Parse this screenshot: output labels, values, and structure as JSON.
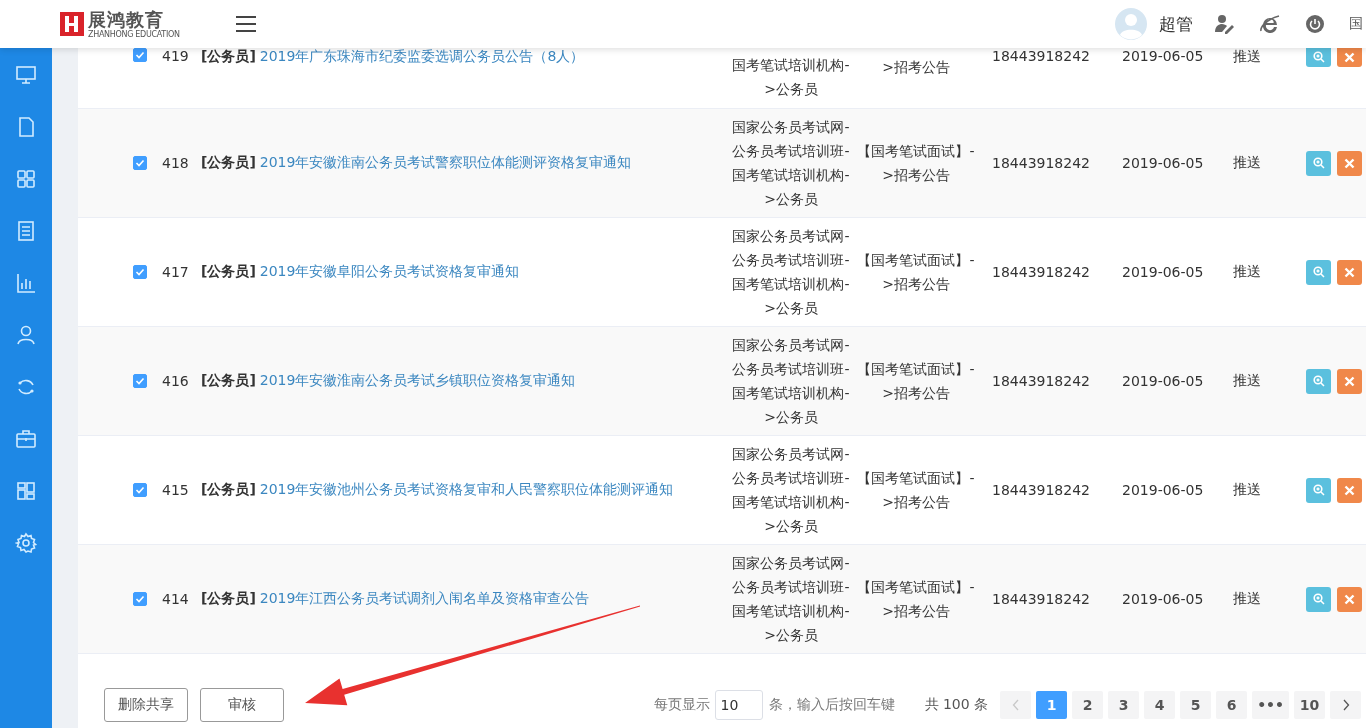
{
  "header": {
    "logo_text": "展鸿教育",
    "logo_subtitle": "ZHANHONG EDUCATION",
    "user": "超管",
    "cut_text": "国"
  },
  "rows": [
    {
      "checked": true,
      "id": "419",
      "tag": "[公务员]",
      "title": "2019年广东珠海市纪委监委选调公务员公告（8人）",
      "category": [
        "国考笔试培训机构-",
        ">公务员"
      ],
      "section": [
        ">招考公告"
      ],
      "phone": "18443918242",
      "date": "2019-06-05",
      "status": "推送"
    },
    {
      "checked": true,
      "id": "418",
      "tag": "[公务员]",
      "title": "2019年安徽淮南公务员考试警察职位体能测评资格复审通知",
      "category": [
        "国家公务员考试网-",
        "公务员考试培训班-",
        "国考笔试培训机构-",
        ">公务员"
      ],
      "section": [
        "【国考笔试面试】-",
        ">招考公告"
      ],
      "phone": "18443918242",
      "date": "2019-06-05",
      "status": "推送"
    },
    {
      "checked": true,
      "id": "417",
      "tag": "[公务员]",
      "title": "2019年安徽阜阳公务员考试资格复审通知",
      "category": [
        "国家公务员考试网-",
        "公务员考试培训班-",
        "国考笔试培训机构-",
        ">公务员"
      ],
      "section": [
        "【国考笔试面试】-",
        ">招考公告"
      ],
      "phone": "18443918242",
      "date": "2019-06-05",
      "status": "推送"
    },
    {
      "checked": true,
      "id": "416",
      "tag": "[公务员]",
      "title": "2019年安徽淮南公务员考试乡镇职位资格复审通知",
      "category": [
        "国家公务员考试网-",
        "公务员考试培训班-",
        "国考笔试培训机构-",
        ">公务员"
      ],
      "section": [
        "【国考笔试面试】-",
        ">招考公告"
      ],
      "phone": "18443918242",
      "date": "2019-06-05",
      "status": "推送"
    },
    {
      "checked": true,
      "id": "415",
      "tag": "[公务员]",
      "title": "2019年安徽池州公务员考试资格复审和人民警察职位体能测评通知",
      "category": [
        "国家公务员考试网-",
        "公务员考试培训班-",
        "国考笔试培训机构-",
        ">公务员"
      ],
      "section": [
        "【国考笔试面试】-",
        ">招考公告"
      ],
      "phone": "18443918242",
      "date": "2019-06-05",
      "status": "推送"
    },
    {
      "checked": true,
      "id": "414",
      "tag": "[公务员]",
      "title": "2019年江西公务员考试调剂入闱名单及资格审查公告",
      "category": [
        "国家公务员考试网-",
        "公务员考试培训班-",
        "国考笔试培训机构-",
        ">公务员"
      ],
      "section": [
        "【国考笔试面试】-",
        ">招考公告"
      ],
      "phone": "18443918242",
      "date": "2019-06-05",
      "status": "推送"
    }
  ],
  "footer": {
    "buttons": [
      "删除共享",
      "审核"
    ],
    "page_size_label": "每页显示",
    "page_size": "10",
    "page_size_hint": "条，输入后按回车键",
    "total": "共 100 条",
    "prev_disabled": true,
    "pages": [
      {
        "label": "1",
        "selected": true
      },
      {
        "label": "2",
        "selected": false
      },
      {
        "label": "3",
        "selected": false
      },
      {
        "label": "4",
        "selected": false
      },
      {
        "label": "5",
        "selected": false
      },
      {
        "label": "6",
        "selected": false
      },
      {
        "label": "•••",
        "selected": false
      },
      {
        "label": "10",
        "selected": false
      }
    ]
  }
}
